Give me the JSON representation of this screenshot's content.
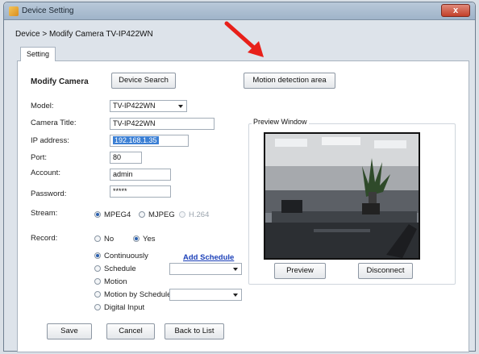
{
  "window": {
    "title": "Device Setting",
    "close_label": "x"
  },
  "breadcrumb": "Device > Modify Camera TV-IP422WN",
  "tabs": [
    {
      "label": "Setting"
    }
  ],
  "section": {
    "heading": "Modify Camera",
    "device_search_label": "Device Search",
    "motion_area_label": "Motion detection area"
  },
  "form": {
    "model_label": "Model:",
    "model_value": "TV-IP422WN",
    "title_label": "Camera Title:",
    "title_value": "TV-IP422WN",
    "ip_label": "IP address:",
    "ip_value": "192.168.1.35",
    "port_label": "Port:",
    "port_value": "80",
    "account_label": "Account:",
    "account_value": "admin",
    "password_label": "Password:",
    "password_value": "*****"
  },
  "stream": {
    "label": "Stream:",
    "options": [
      "MPEG4",
      "MJPEG",
      "H.264"
    ],
    "selected": "MPEG4"
  },
  "record": {
    "label": "Record:",
    "no_label": "No",
    "yes_label": "Yes",
    "selected": "Yes",
    "modes": [
      "Continuously",
      "Schedule",
      "Motion",
      "Motion by Schedule",
      "Digital Input"
    ],
    "selected_mode": "Continuously",
    "add_schedule_label": "Add Schedule"
  },
  "preview": {
    "group_title": "Preview Window",
    "preview_label": "Preview",
    "disconnect_label": "Disconnect"
  },
  "footer": {
    "save_label": "Save",
    "cancel_label": "Cancel",
    "back_label": "Back to List"
  },
  "annotation": {
    "arrow_color": "#e8201a"
  },
  "icons": {
    "window_icon": "app-icon",
    "close_icon": "close-icon",
    "dropdown_icon": "chevron-down-icon",
    "annotation_arrow": "arrow-icon"
  }
}
